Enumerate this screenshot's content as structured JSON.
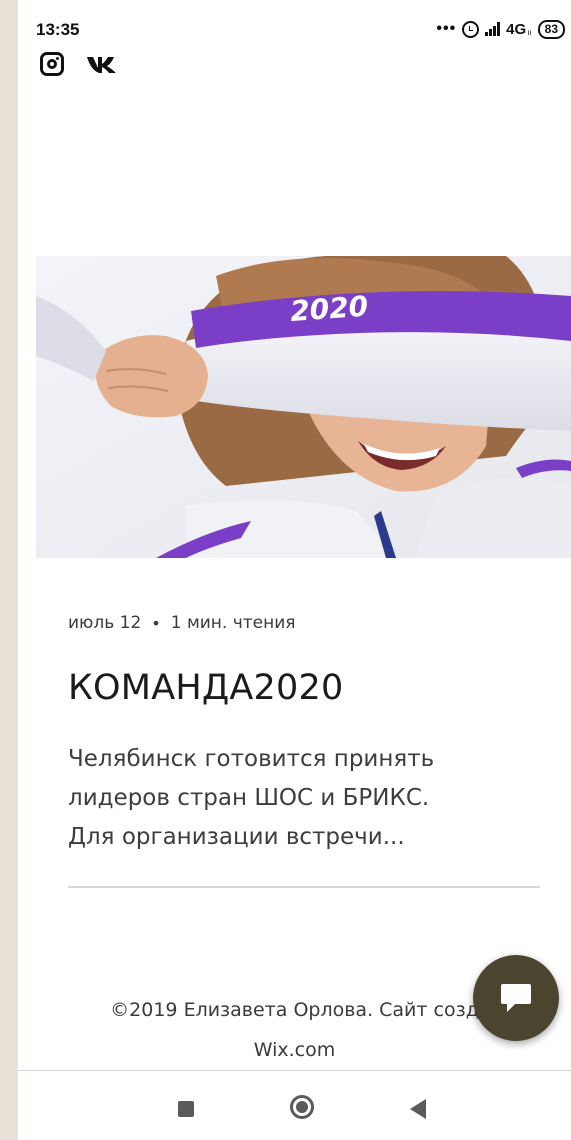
{
  "status_bar": {
    "time": "13:35",
    "dots": "•••",
    "network": "4G",
    "network_sub": "ıı",
    "battery": "83"
  },
  "social": {
    "icons": [
      "instagram-icon",
      "vk-icon"
    ]
  },
  "hero": {
    "jersey_text": "2020"
  },
  "post": {
    "date": "июль 12",
    "separator": "•",
    "read_time": "1 мин. чтения",
    "title": "КОМАНДА2020",
    "excerpt_lines": [
      "Челябинск готовится принять",
      "лидеров стран ШОС и БРИКС.",
      "Для организации встречи..."
    ]
  },
  "footer": {
    "line1": "©2019 Елизавета Орлова. Сайт созд",
    "line2": "Wix.com"
  },
  "colors": {
    "accent_purple": "#7b3fc7",
    "chat_button": "#4b4530",
    "page_bg": "#e8e1d8"
  },
  "navbar": {
    "icons": [
      "recent-apps-icon",
      "home-icon",
      "back-icon"
    ]
  }
}
